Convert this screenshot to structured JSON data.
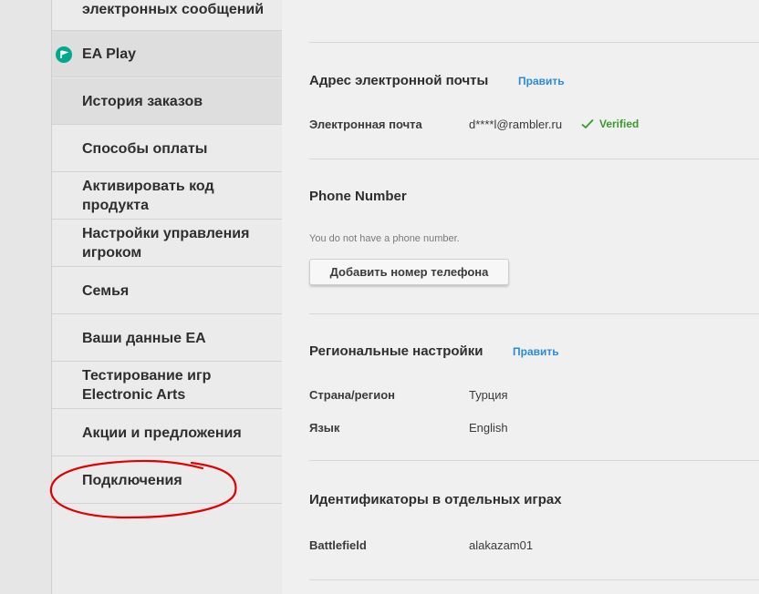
{
  "sidebar": {
    "items": [
      {
        "label": "Предпочтения\nэлектронных сообщений"
      },
      {
        "label": "EA Play",
        "icon": "ea-play-flag-icon"
      },
      {
        "label": "История заказов"
      },
      {
        "label": "Способы оплаты"
      },
      {
        "label": "Активировать код\nпродукта"
      },
      {
        "label": "Настройки управления\nигроком"
      },
      {
        "label": "Семья"
      },
      {
        "label": "Ваши данные EA"
      },
      {
        "label": "Тестирование игр\nElectronic Arts"
      },
      {
        "label": "Акции и предложения"
      },
      {
        "label": "Подключения"
      }
    ]
  },
  "email": {
    "title": "Адрес электронной почты",
    "edit": "Править",
    "label": "Электронная почта",
    "value": "d****l@rambler.ru",
    "status": "Verified"
  },
  "phone": {
    "title": "Phone Number",
    "note": "You do not have a phone number.",
    "add_button": "Добавить номер телефона"
  },
  "region": {
    "title": "Региональные настройки",
    "edit": "Править",
    "country_label": "Страна/регион",
    "country_value": "Турция",
    "language_label": "Язык",
    "language_value": "English"
  },
  "game_ids": {
    "title": "Идентификаторы в отдельных играх",
    "game_label": "Battlefield",
    "game_value": "alakazam01"
  },
  "colors": {
    "accent_link": "#2a8bd8",
    "verified": "#3a9a2a",
    "ea_flag": "#00a88e",
    "annotation": "#e00000"
  }
}
